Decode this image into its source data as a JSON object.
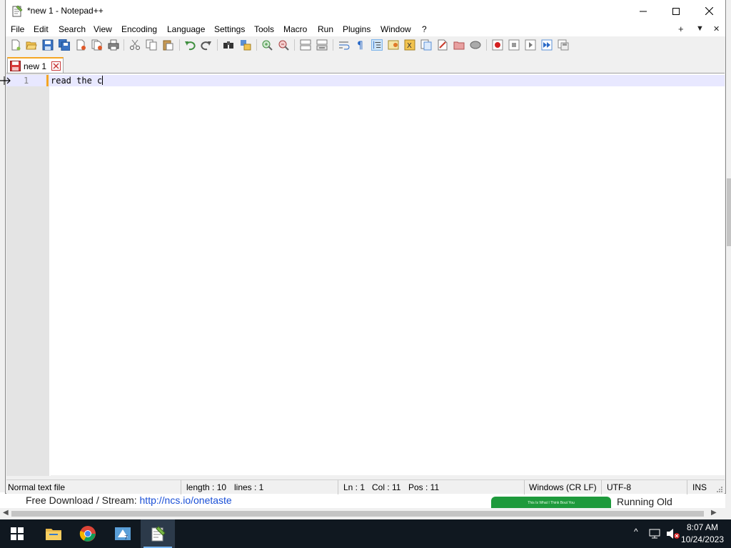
{
  "window": {
    "title": "*new 1 - Notepad++",
    "controls": {
      "minimize": "minimize",
      "maximize": "maximize",
      "close": "close"
    }
  },
  "menubar": {
    "items": [
      "File",
      "Edit",
      "Search",
      "View",
      "Encoding",
      "Language",
      "Settings",
      "Tools",
      "Macro",
      "Run",
      "Plugins",
      "Window",
      "?"
    ],
    "right": [
      "+",
      "▼",
      "✕"
    ]
  },
  "toolbar": {
    "icons": [
      "new-file",
      "open-file",
      "save",
      "save-all",
      "close",
      "close-all",
      "print",
      "cut",
      "copy",
      "paste",
      "undo",
      "redo",
      "find",
      "replace",
      "zoom-in",
      "zoom-out",
      "sync-vertical",
      "sync-horizontal",
      "word-wrap",
      "show-all-chars",
      "indent-guide",
      "user-language",
      "doc-map",
      "function-list",
      "folder-workspace",
      "monitoring",
      "record-macro",
      "stop-recording",
      "play-macro",
      "run-macro-multiple",
      "save-macro"
    ]
  },
  "tabs": [
    {
      "label": "new 1",
      "modified": true
    }
  ],
  "editor": {
    "lines": [
      {
        "number": "1",
        "text": "read the c"
      }
    ]
  },
  "statusbar": {
    "file_type": "Normal text file",
    "length": "length : 10",
    "lines": "lines : 1",
    "ln": "Ln : 1",
    "col": "Col : 11",
    "pos": "Pos : 11",
    "eol": "Windows (CR LF)",
    "encoding": "UTF-8",
    "mode": "INS"
  },
  "background_page": {
    "text_prefix": "Free Download / Stream: ",
    "link": "http://ncs.io/onetaste",
    "banner_text": "This Is What I Think Bout You",
    "running_text": "Running Old"
  },
  "taskbar": {
    "apps": [
      "start",
      "file-explorer",
      "chrome",
      "app-4",
      "notepad-plus-plus"
    ],
    "time": "8:07 AM",
    "date": "10/24/2023"
  },
  "colors": {
    "tab_accent": "#f5a623",
    "current_line": "#e8e8ff",
    "taskbar": "#101820",
    "link": "#1a4fd6"
  }
}
